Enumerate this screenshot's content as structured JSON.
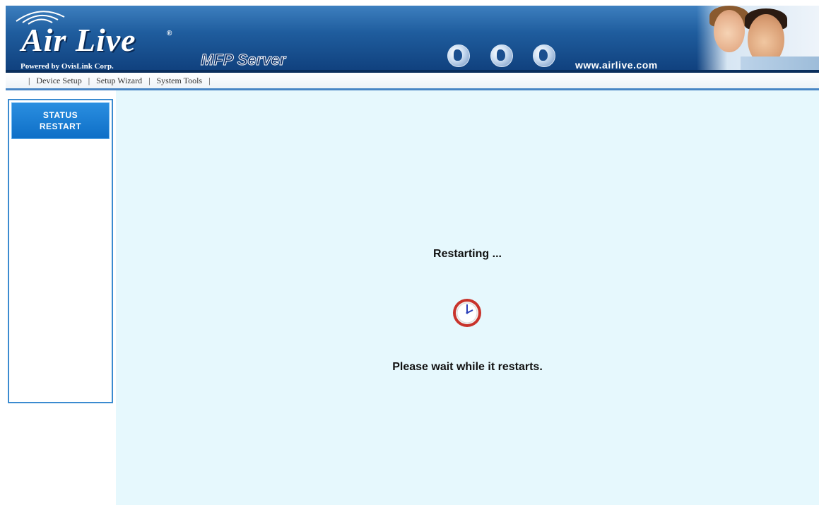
{
  "header": {
    "brand": "Air Live",
    "powered_by": "Powered by OvisLink Corp.",
    "product": "MFP Server",
    "website": "www.airlive.com"
  },
  "menu": {
    "items": [
      {
        "label": "Device Setup"
      },
      {
        "label": "Setup Wizard"
      },
      {
        "label": "System Tools"
      }
    ]
  },
  "sidebar": {
    "button_line1": "STATUS",
    "button_line2": "RESTART"
  },
  "main": {
    "restarting_text": "Restarting ...",
    "wait_text": "Please wait while it restarts.",
    "icon": "clock-icon"
  },
  "colors": {
    "banner": "#1f5d9e",
    "sidebar_button": "#0e6fc7",
    "content_bg": "#e6f8fd",
    "clock_ring": "#c8332b"
  }
}
